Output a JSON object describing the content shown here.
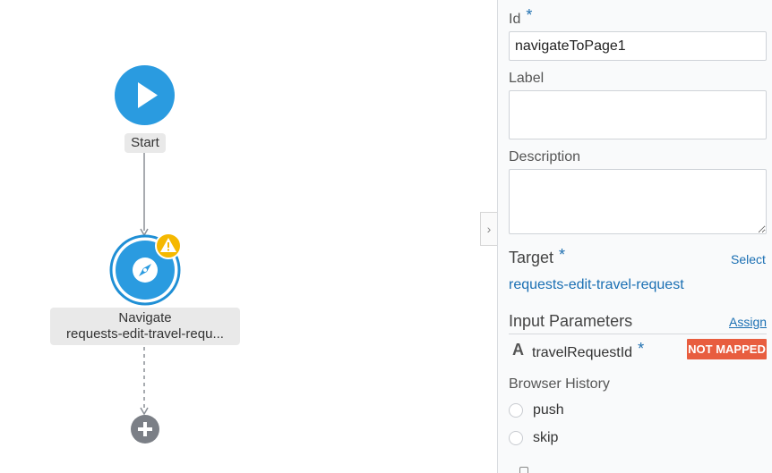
{
  "canvas": {
    "start_label": "Start",
    "navigate_title": "Navigate",
    "navigate_target": "requests-edit-travel-requ...",
    "start_icon": "play-icon",
    "navigate_icon": "compass-icon",
    "warning_icon": "warning-icon",
    "add_icon": "plus-icon",
    "colors": {
      "node": "#2a9be0",
      "warning": "#f5b800",
      "add": "#7b7f86"
    }
  },
  "panel": {
    "collapse_icon": "chevron-right-icon",
    "id_label": "Id",
    "id_value": "navigateToPage1",
    "label_label": "Label",
    "label_value": "",
    "description_label": "Description",
    "description_value": "",
    "target_label": "Target",
    "target_select": "Select",
    "target_value": "requests-edit-travel-request",
    "input_params_label": "Input Parameters",
    "assign_link": "Assign",
    "param_type_icon": "string-type-icon",
    "param_name": "travelRequestId",
    "param_status": "NOT MAPPED",
    "browser_history_label": "Browser History",
    "history_options": [
      "push",
      "skip"
    ],
    "required_mark": "*"
  }
}
